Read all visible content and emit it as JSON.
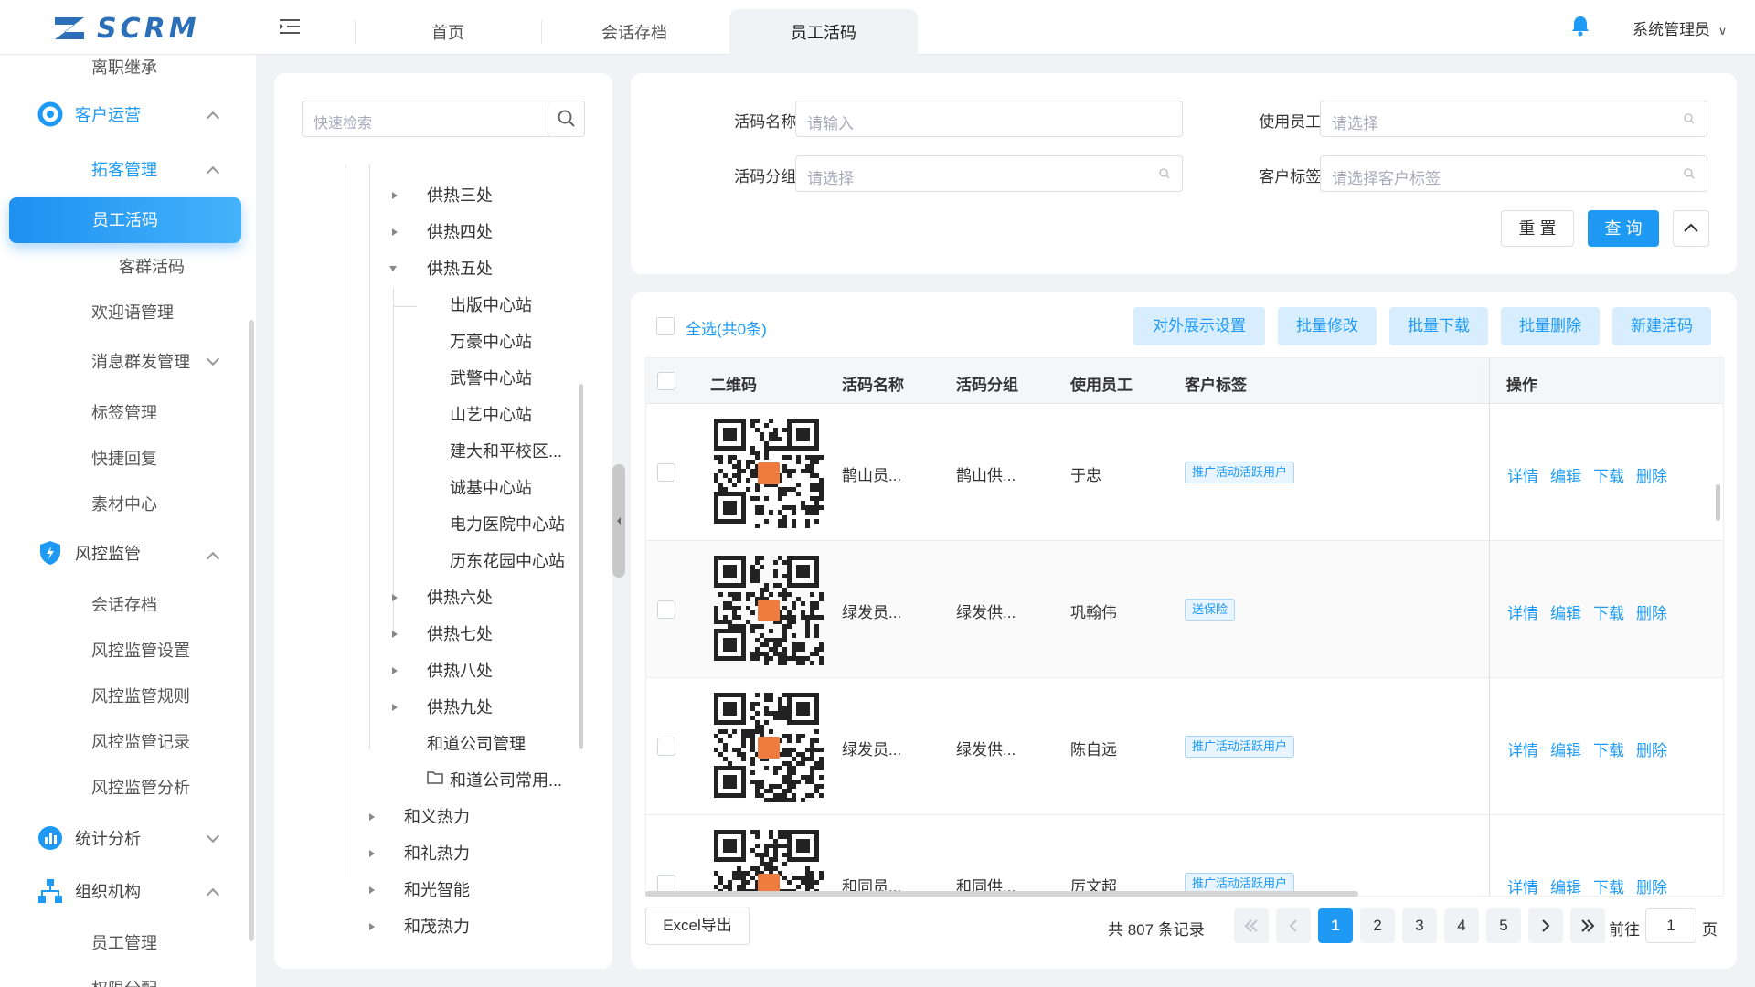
{
  "header": {
    "logo_text": "SCRM",
    "tabs": [
      {
        "label": "首页"
      },
      {
        "label": "会话存档"
      },
      {
        "label": "员工活码"
      }
    ],
    "user": "系统管理员"
  },
  "sidebar": {
    "top_item": "离职继承",
    "customer_ops": "客户运营",
    "tuoke": "拓客管理",
    "active_item": "员工活码",
    "items_a": [
      "客群活码",
      "欢迎语管理",
      "消息群发管理",
      "标签管理",
      "快捷回复",
      "素材中心"
    ],
    "risk": "风控监管",
    "items_b": [
      "会话存档",
      "风控监管设置",
      "风控监管规则",
      "风控监管记录",
      "风控监管分析"
    ],
    "stats": "统计分析",
    "org": "组织机构",
    "items_c": [
      "员工管理",
      "权限分配"
    ]
  },
  "tree": {
    "search_placeholder": "快速检索",
    "nodes": [
      "供热三处",
      "供热四处",
      "供热五处",
      "出版中心站",
      "万豪中心站",
      "武警中心站",
      "山艺中心站",
      "建大和平校区...",
      "诚基中心站",
      "电力医院中心站",
      "历东花园中心站",
      "供热六处",
      "供热七处",
      "供热八处",
      "供热九处",
      "和道公司管理",
      "和道公司常用...",
      "和义热力",
      "和礼热力",
      "和光智能",
      "和茂热力"
    ]
  },
  "filter": {
    "name_label": "活码名称:",
    "name_placeholder": "请输入",
    "employee_label": "使用员工:",
    "employee_placeholder": "请选择",
    "group_label": "活码分组:",
    "group_placeholder": "请选择",
    "tag_label": "客户标签:",
    "tag_placeholder": "请选择客户标签",
    "reset": "重 置",
    "query": "查 询"
  },
  "toolbar": {
    "select_all": "全选(共0条)",
    "buttons": [
      "对外展示设置",
      "批量修改",
      "批量下载",
      "批量删除",
      "新建活码"
    ]
  },
  "table": {
    "headers": [
      "二维码",
      "活码名称",
      "活码分组",
      "使用员工",
      "客户标签",
      "操作"
    ],
    "rows": [
      {
        "name": "鹊山员...",
        "group": "鹊山供...",
        "employee": "于忠",
        "tag": "推广活动活跃用户"
      },
      {
        "name": "绿发员...",
        "group": "绿发供...",
        "employee": "巩翰伟",
        "tag": "送保险"
      },
      {
        "name": "绿发员...",
        "group": "绿发供...",
        "employee": "陈自远",
        "tag": "推广活动活跃用户"
      },
      {
        "name": "和同员...",
        "group": "和同供...",
        "employee": "厉文超",
        "tag": "推广活动活跃用户"
      }
    ],
    "ops": [
      "详情",
      "编辑",
      "下载",
      "删除"
    ]
  },
  "footer": {
    "excel": "Excel导出",
    "total": "共 807 条记录",
    "pages": [
      "1",
      "2",
      "3",
      "4",
      "5"
    ],
    "goto_label": "前往",
    "goto_value": "1",
    "page_suffix": "页"
  },
  "colors": {
    "accent": "#1e9af5",
    "logo": "#2b6fb8"
  }
}
